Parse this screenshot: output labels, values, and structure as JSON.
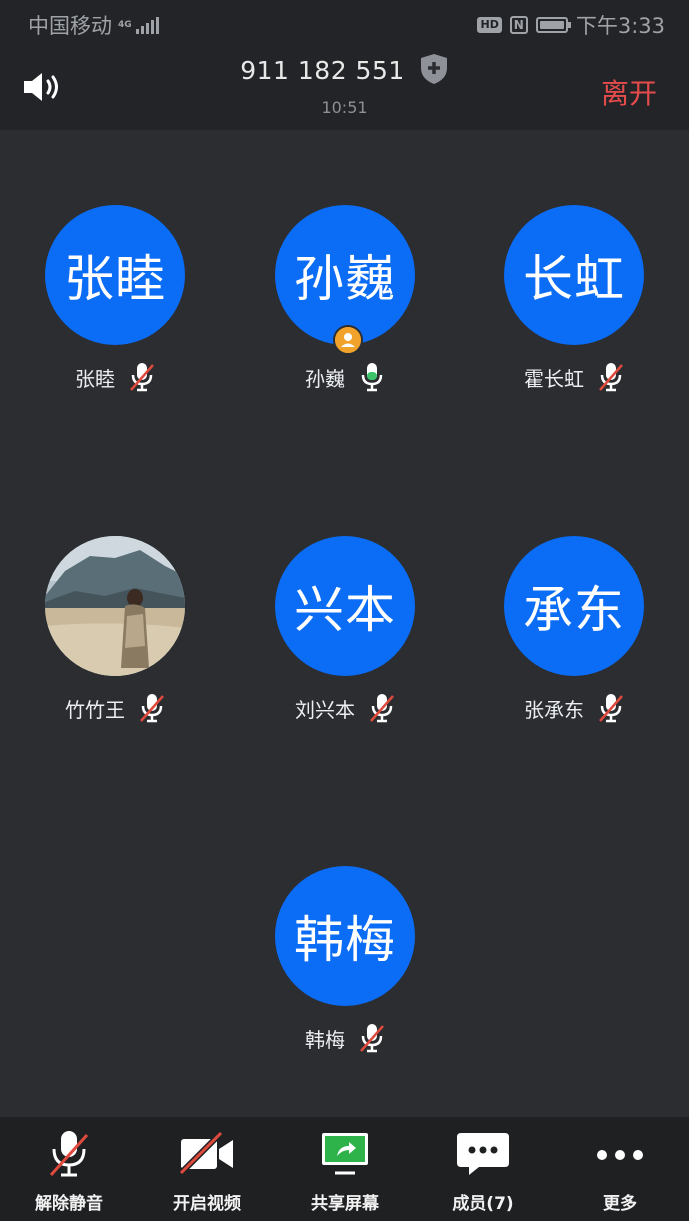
{
  "status_bar": {
    "carrier": "中国移动",
    "network": "4G",
    "hd": "HD",
    "nfc": "N",
    "time": "下午3:33"
  },
  "header": {
    "meeting_id": "911 182 551",
    "duration": "10:51",
    "leave_label": "离开"
  },
  "participants": [
    {
      "avatar_text": "张睦",
      "name": "张睦",
      "mic": "muted"
    },
    {
      "avatar_text": "孙巍",
      "name": "孙巍",
      "mic": "active",
      "host": true
    },
    {
      "avatar_text": "长虹",
      "name": "霍长虹",
      "mic": "muted"
    },
    {
      "avatar_text": "",
      "name": "竹竹王",
      "mic": "muted",
      "photo": true
    },
    {
      "avatar_text": "兴本",
      "name": "刘兴本",
      "mic": "muted"
    },
    {
      "avatar_text": "承东",
      "name": "张承东",
      "mic": "muted"
    },
    {
      "avatar_text": "韩梅",
      "name": "韩梅",
      "mic": "muted"
    }
  ],
  "toolbar": {
    "unmute": "解除静音",
    "start_video": "开启视频",
    "share_screen": "共享屏幕",
    "members": "成员(7)",
    "more": "更多"
  },
  "colors": {
    "avatar": "#0b6cf5",
    "leave": "#e74c4c",
    "mic_active": "#3cc36a",
    "mute_slash": "#e04a3c",
    "share": "#2db34a",
    "host_badge": "#f0a22a"
  }
}
